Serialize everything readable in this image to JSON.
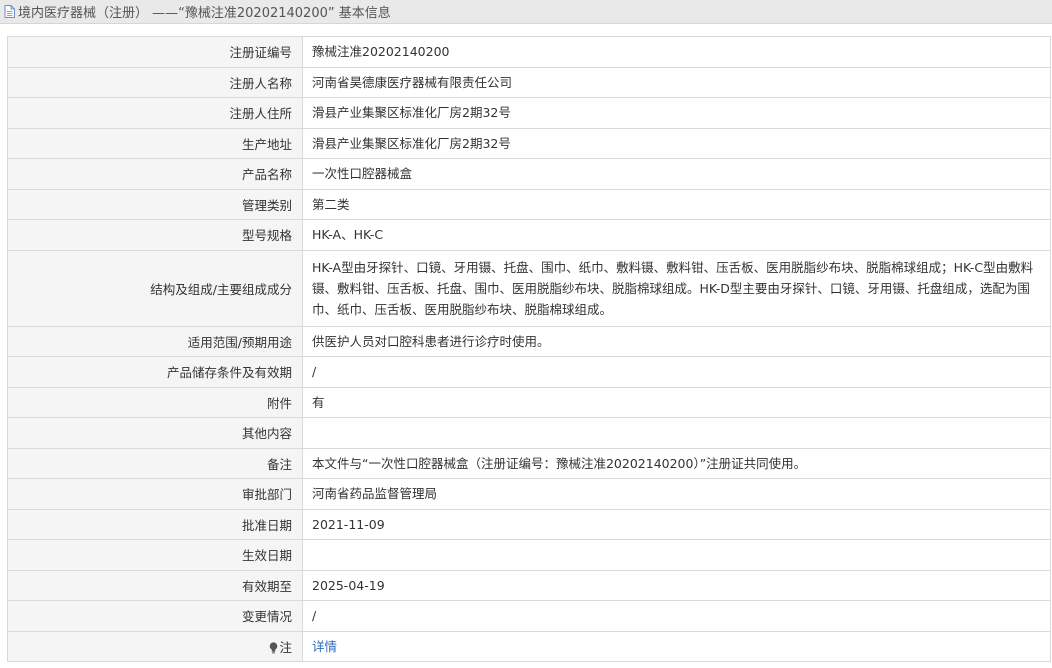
{
  "page": {
    "title_prefix": "境内医疗器械（注册） ——",
    "title_quoted": "“豫械注准20202140200”",
    "title_suffix": " 基本信息"
  },
  "rows": {
    "reg_no": {
      "label": "注册证编号",
      "value": "豫械注准20202140200"
    },
    "registrant_name": {
      "label": "注册人名称",
      "value": "河南省昊德康医疗器械有限责任公司"
    },
    "registrant_address": {
      "label": "注册人住所",
      "value": "滑县产业集聚区标准化厂房2期32号"
    },
    "production_address": {
      "label": "生产地址",
      "value": "滑县产业集聚区标准化厂房2期32号"
    },
    "product_name": {
      "label": "产品名称",
      "value": "一次性口腔器械盒"
    },
    "management_class": {
      "label": "管理类别",
      "value": "第二类"
    },
    "model_spec": {
      "label": "型号规格",
      "value": "HK-A、HK-C"
    },
    "structure": {
      "label": "结构及组成/主要组成成分",
      "value": "HK-A型由牙探针、口镜、牙用镊、托盘、围巾、纸巾、敷料镊、敷料钳、压舌板、医用脱脂纱布块、脱脂棉球组成；HK-C型由敷料镊、敷料钳、压舌板、托盘、围巾、医用脱脂纱布块、脱脂棉球组成。HK-D型主要由牙探针、口镜、牙用镊、托盘组成，选配为围巾、纸巾、压舌板、医用脱脂纱布块、脱脂棉球组成。"
    },
    "scope": {
      "label": "适用范围/预期用途",
      "value": "供医护人员对口腔科患者进行诊疗时使用。"
    },
    "storage": {
      "label": "产品储存条件及有效期",
      "value": "/"
    },
    "attachment": {
      "label": "附件",
      "value": "有"
    },
    "other": {
      "label": "其他内容",
      "value": ""
    },
    "remark": {
      "label": "备注",
      "value": "本文件与“一次性口腔器械盒（注册证编号：豫械注准20202140200）”注册证共同使用。"
    },
    "approval_dept": {
      "label": "审批部门",
      "value": "河南省药品监督管理局"
    },
    "approval_date": {
      "label": "批准日期",
      "value": "2021-11-09"
    },
    "effective_date": {
      "label": "生效日期",
      "value": ""
    },
    "valid_until": {
      "label": "有效期至",
      "value": "2025-04-19"
    },
    "change_status": {
      "label": "变更情况",
      "value": "/"
    },
    "note": {
      "label": "注",
      "value": "详情"
    }
  },
  "icons": {
    "title": "document-icon",
    "note": "lightbulb-icon"
  },
  "colors": {
    "link": "#2a6bc2",
    "label_bg": "#f5f5f5",
    "border": "#d9d9d9",
    "title_bar_bg": "#e9e9e9"
  }
}
